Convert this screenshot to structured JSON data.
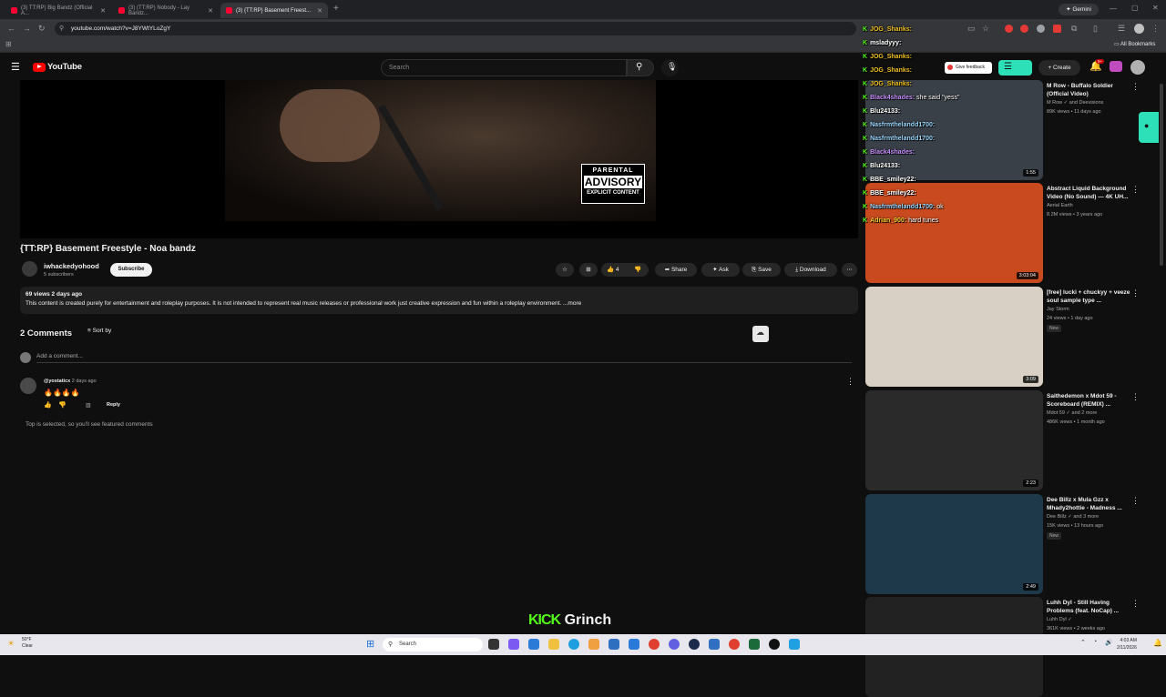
{
  "browser": {
    "tabs": [
      {
        "label": "(3) TT:RP) Big Bandz (Official A..."
      },
      {
        "label": "(3) (TT:RP) Nobody - Lay Bandz..."
      },
      {
        "label": "(3) {TT:RP} Basement Freest..."
      }
    ],
    "url": "youtube.com/watch?v=J8YWtYLoZgY",
    "gemini_label": "Gemini",
    "all_bookmarks": "All Bookmarks"
  },
  "youtube": {
    "logo_text": "YouTube",
    "search_placeholder": "Search",
    "give_feedback": "Give feedback",
    "create_label": "Create",
    "notification_count": "9+"
  },
  "video": {
    "advisory_line1": "PARENTAL",
    "advisory_line2": "ADVISORY",
    "advisory_line3": "EXPLICIT CONTENT",
    "title": "{TT:RP} Basement Freestyle - Noa bandz",
    "channel": "iwhackedyohood",
    "subscribers": "5 subscribers",
    "subscribe_label": "Subscribe",
    "likes": "4",
    "share_label": "Share",
    "ask_label": "Ask",
    "save_label": "Save",
    "download_label": "Download",
    "views_date": "69 views  2 days ago",
    "description": "This content is created purely for entertainment and roleplay purposes. It is not intended to represent real music releases or professional work just creative expression and fun within a roleplay environment. ...more"
  },
  "comments": {
    "count_label": "2 Comments",
    "sort_label": "Sort by",
    "add_placeholder": "Add a comment...",
    "items": [
      {
        "author": "@yostaticx",
        "time": "2 days ago",
        "text": "🔥🔥🔥🔥",
        "reply_label": "Reply"
      }
    ],
    "top_note": "Top is selected, so you'll see featured comments"
  },
  "recommendations": [
    {
      "title": "M Row - Buffalo Soldier (Official Video)",
      "channel": "M Row ✓ and Deevisions",
      "meta": "89K views • 11 days ago",
      "duration": "1:55",
      "color": "#3a4048"
    },
    {
      "title": "Abstract Liquid Background Video (No Sound) — 4K UH...",
      "channel": "Aerial Earth",
      "meta": "8.2M views • 3 years ago",
      "duration": "3:03:04",
      "color": "#c84a1e"
    },
    {
      "title": "[free] lucki + chuckyy + veeze  soul sample type ...",
      "channel": "Jay Storm",
      "meta": "24 views • 1 day ago",
      "badge": "New",
      "duration": "3:09",
      "color": "#d8d0c4"
    },
    {
      "title": "Saithedemon x Mdot 59 - Scoreboard (REMIX) ...",
      "channel": "Mdot 59 ✓ and 2 more",
      "meta": "486K views • 1 month ago",
      "duration": "2:23",
      "color": "#2a2a2a"
    },
    {
      "title": "Dee Billz x Mula Gzz x Mhady2hottie - Madness ...",
      "channel": "Dee Billz ✓ and 3 more",
      "meta": "15K views • 13 hours ago",
      "badge": "New",
      "duration": "2:49",
      "color": "#1e3a4a"
    },
    {
      "title": "Luhh Dyl - Still Having Problems (feat. NoCap) ...",
      "channel": "Luhh Dyl ✓",
      "meta": "361K views • 2 weeks ago",
      "duration": "",
      "color": "#222"
    }
  ],
  "chat": [
    {
      "user": "JOG_Shanks:",
      "msg": "",
      "color": "#f0c020"
    },
    {
      "user": "msladyyy:",
      "msg": "",
      "color": "#ffffff"
    },
    {
      "user": "JOG_Shanks:",
      "msg": "",
      "color": "#f0c020"
    },
    {
      "user": "JOG_Shanks:",
      "msg": "",
      "color": "#f0c020"
    },
    {
      "user": "JOG_Shanks:",
      "msg": "",
      "color": "#f0c020"
    },
    {
      "user": "Black4shades:",
      "msg": "she said \"yess\"",
      "color": "#c890ff"
    },
    {
      "user": "Blu24133:",
      "msg": "",
      "color": "#ffffff"
    },
    {
      "user": "Nasfrmthelandd1700:",
      "msg": "",
      "color": "#9ad8ff"
    },
    {
      "user": "Nasfrmthelandd1700:",
      "msg": "",
      "color": "#9ad8ff"
    },
    {
      "user": "Black4shades:",
      "msg": "",
      "color": "#c890ff"
    },
    {
      "user": "Blu24133:",
      "msg": "",
      "color": "#ffffff"
    },
    {
      "user": "BBE_smiley22:",
      "msg": "",
      "color": "#ffffff"
    },
    {
      "user": "BBE_smiley22:",
      "msg": "",
      "color": "#ffffff"
    },
    {
      "user": "Nasfrmthelandd1700:",
      "msg": "ok",
      "color": "#9ad8ff"
    },
    {
      "user": "Adrian_900:",
      "msg": "hard tunes",
      "color": "#ffcc33"
    }
  ],
  "kick": {
    "logo": "KICK",
    "name": "Grinch"
  },
  "taskbar": {
    "weather_temp": "50°F",
    "weather_desc": "Clear",
    "search_label": "Search",
    "time": "4:03 AM",
    "date": "2/11/2026"
  }
}
